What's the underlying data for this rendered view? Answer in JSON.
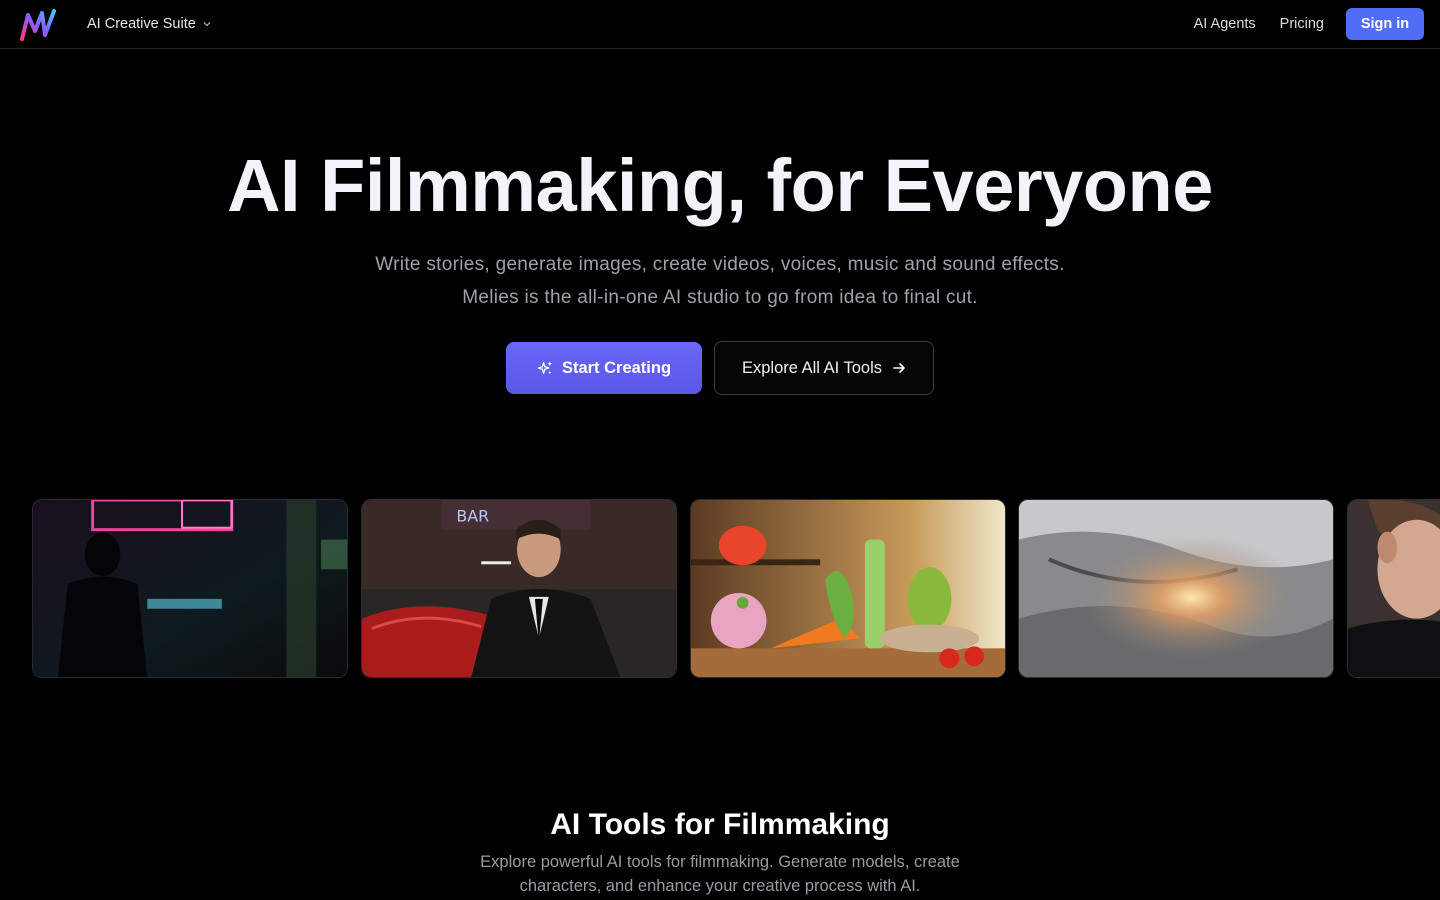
{
  "header": {
    "suite_label": "AI Creative Suite",
    "nav": {
      "agents": "AI Agents",
      "pricing": "Pricing",
      "signin": "Sign in"
    }
  },
  "hero": {
    "title": "AI Filmmaking, for Everyone",
    "subtitle_line1": "Write stories, generate images, create videos, voices, music and sound effects.",
    "subtitle_line2": "Melies is the all-in-one AI studio to go from idea to final cut.",
    "start_label": "Start Creating",
    "explore_label": "Explore All AI Tools"
  },
  "gallery": {
    "items": [
      {
        "scene": "neon-street-silhouette"
      },
      {
        "scene": "man-smoking-by-red-car"
      },
      {
        "scene": "animated-vegetables-kitchen"
      },
      {
        "scene": "explosion-grayscale-terrain"
      },
      {
        "scene": "man-profile-closeup"
      }
    ]
  },
  "tools": {
    "title": "AI Tools for Filmmaking",
    "subtitle": "Explore powerful AI tools for filmmaking. Generate models, create characters, and enhance your creative process with AI."
  },
  "colors": {
    "accent": "#4f6df5",
    "start_button": "#6a67f7",
    "background": "#000000"
  }
}
